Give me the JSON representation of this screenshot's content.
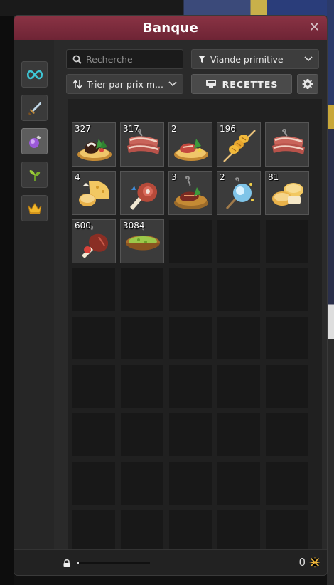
{
  "window": {
    "title": "Banque"
  },
  "tabs": [
    {
      "name": "tab-all",
      "icon": "infinity-icon",
      "active": false
    },
    {
      "name": "tab-equipment",
      "icon": "sword-icon",
      "active": false
    },
    {
      "name": "tab-consumables",
      "icon": "potion-icon",
      "active": true
    },
    {
      "name": "tab-resources",
      "icon": "plant-icon",
      "active": false
    },
    {
      "name": "tab-cosmetics",
      "icon": "crown-icon",
      "active": false
    }
  ],
  "search": {
    "placeholder": "Recherche",
    "value": ""
  },
  "filter": {
    "selected": "Viande primitive"
  },
  "sort": {
    "selected": "Trier par prix m..."
  },
  "recipes": {
    "label": "RECETTES"
  },
  "items": [
    {
      "qty": "327",
      "icon": "meat-platter-icon"
    },
    {
      "qty": "317",
      "icon": "bacon-slices-icon"
    },
    {
      "qty": "2",
      "icon": "grilled-steak-plate-icon"
    },
    {
      "qty": "196",
      "icon": "skewer-icon"
    },
    {
      "qty": "",
      "icon": "bacon-slices-icon"
    },
    {
      "qty": "4",
      "icon": "cheese-bread-icon"
    },
    {
      "qty": "",
      "icon": "ham-leg-icon"
    },
    {
      "qty": "3",
      "icon": "smoking-stew-icon"
    },
    {
      "qty": "2",
      "icon": "magic-orb-icon"
    },
    {
      "qty": "81",
      "icon": "bread-rolls-icon"
    },
    {
      "qty": "600",
      "icon": "roast-leg-icon"
    },
    {
      "qty": "3084",
      "icon": "soup-bowl-icon"
    }
  ],
  "total_slots": 45,
  "footer": {
    "capacity_fraction": 0.02,
    "kamas": "0"
  }
}
